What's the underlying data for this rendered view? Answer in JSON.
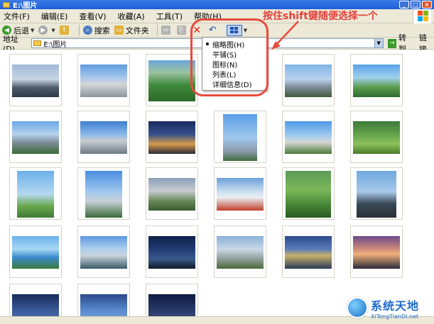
{
  "window": {
    "title": "E:\\图片"
  },
  "menubar": {
    "items": [
      "文件(F)",
      "编辑(E)",
      "查看(V)",
      "收藏(A)",
      "工具(T)",
      "帮助(H)"
    ]
  },
  "toolbar": {
    "back_label": "后退",
    "search_label": "搜索",
    "folders_label": "文件夹"
  },
  "address": {
    "label": "地址(D)",
    "value": "E:\\图片",
    "go_label": "转到",
    "links_label": "链接"
  },
  "view_menu": {
    "items": [
      "缩略图(H)",
      "平铺(S)",
      "图标(N)",
      "列表(L)",
      "详细信息(D)"
    ],
    "selected_index": 0
  },
  "annotation": {
    "text": "按住shift键随便选择一个",
    "color": "#e84a3e"
  },
  "watermark": {
    "cn": "系统天地",
    "en": "XiTongTianDi.net"
  },
  "colors": {
    "accent": "#316ac5",
    "window_bg": "#ece9d8",
    "titlebar": "#1f5fd6"
  },
  "thumbnails": {
    "count": 23
  }
}
